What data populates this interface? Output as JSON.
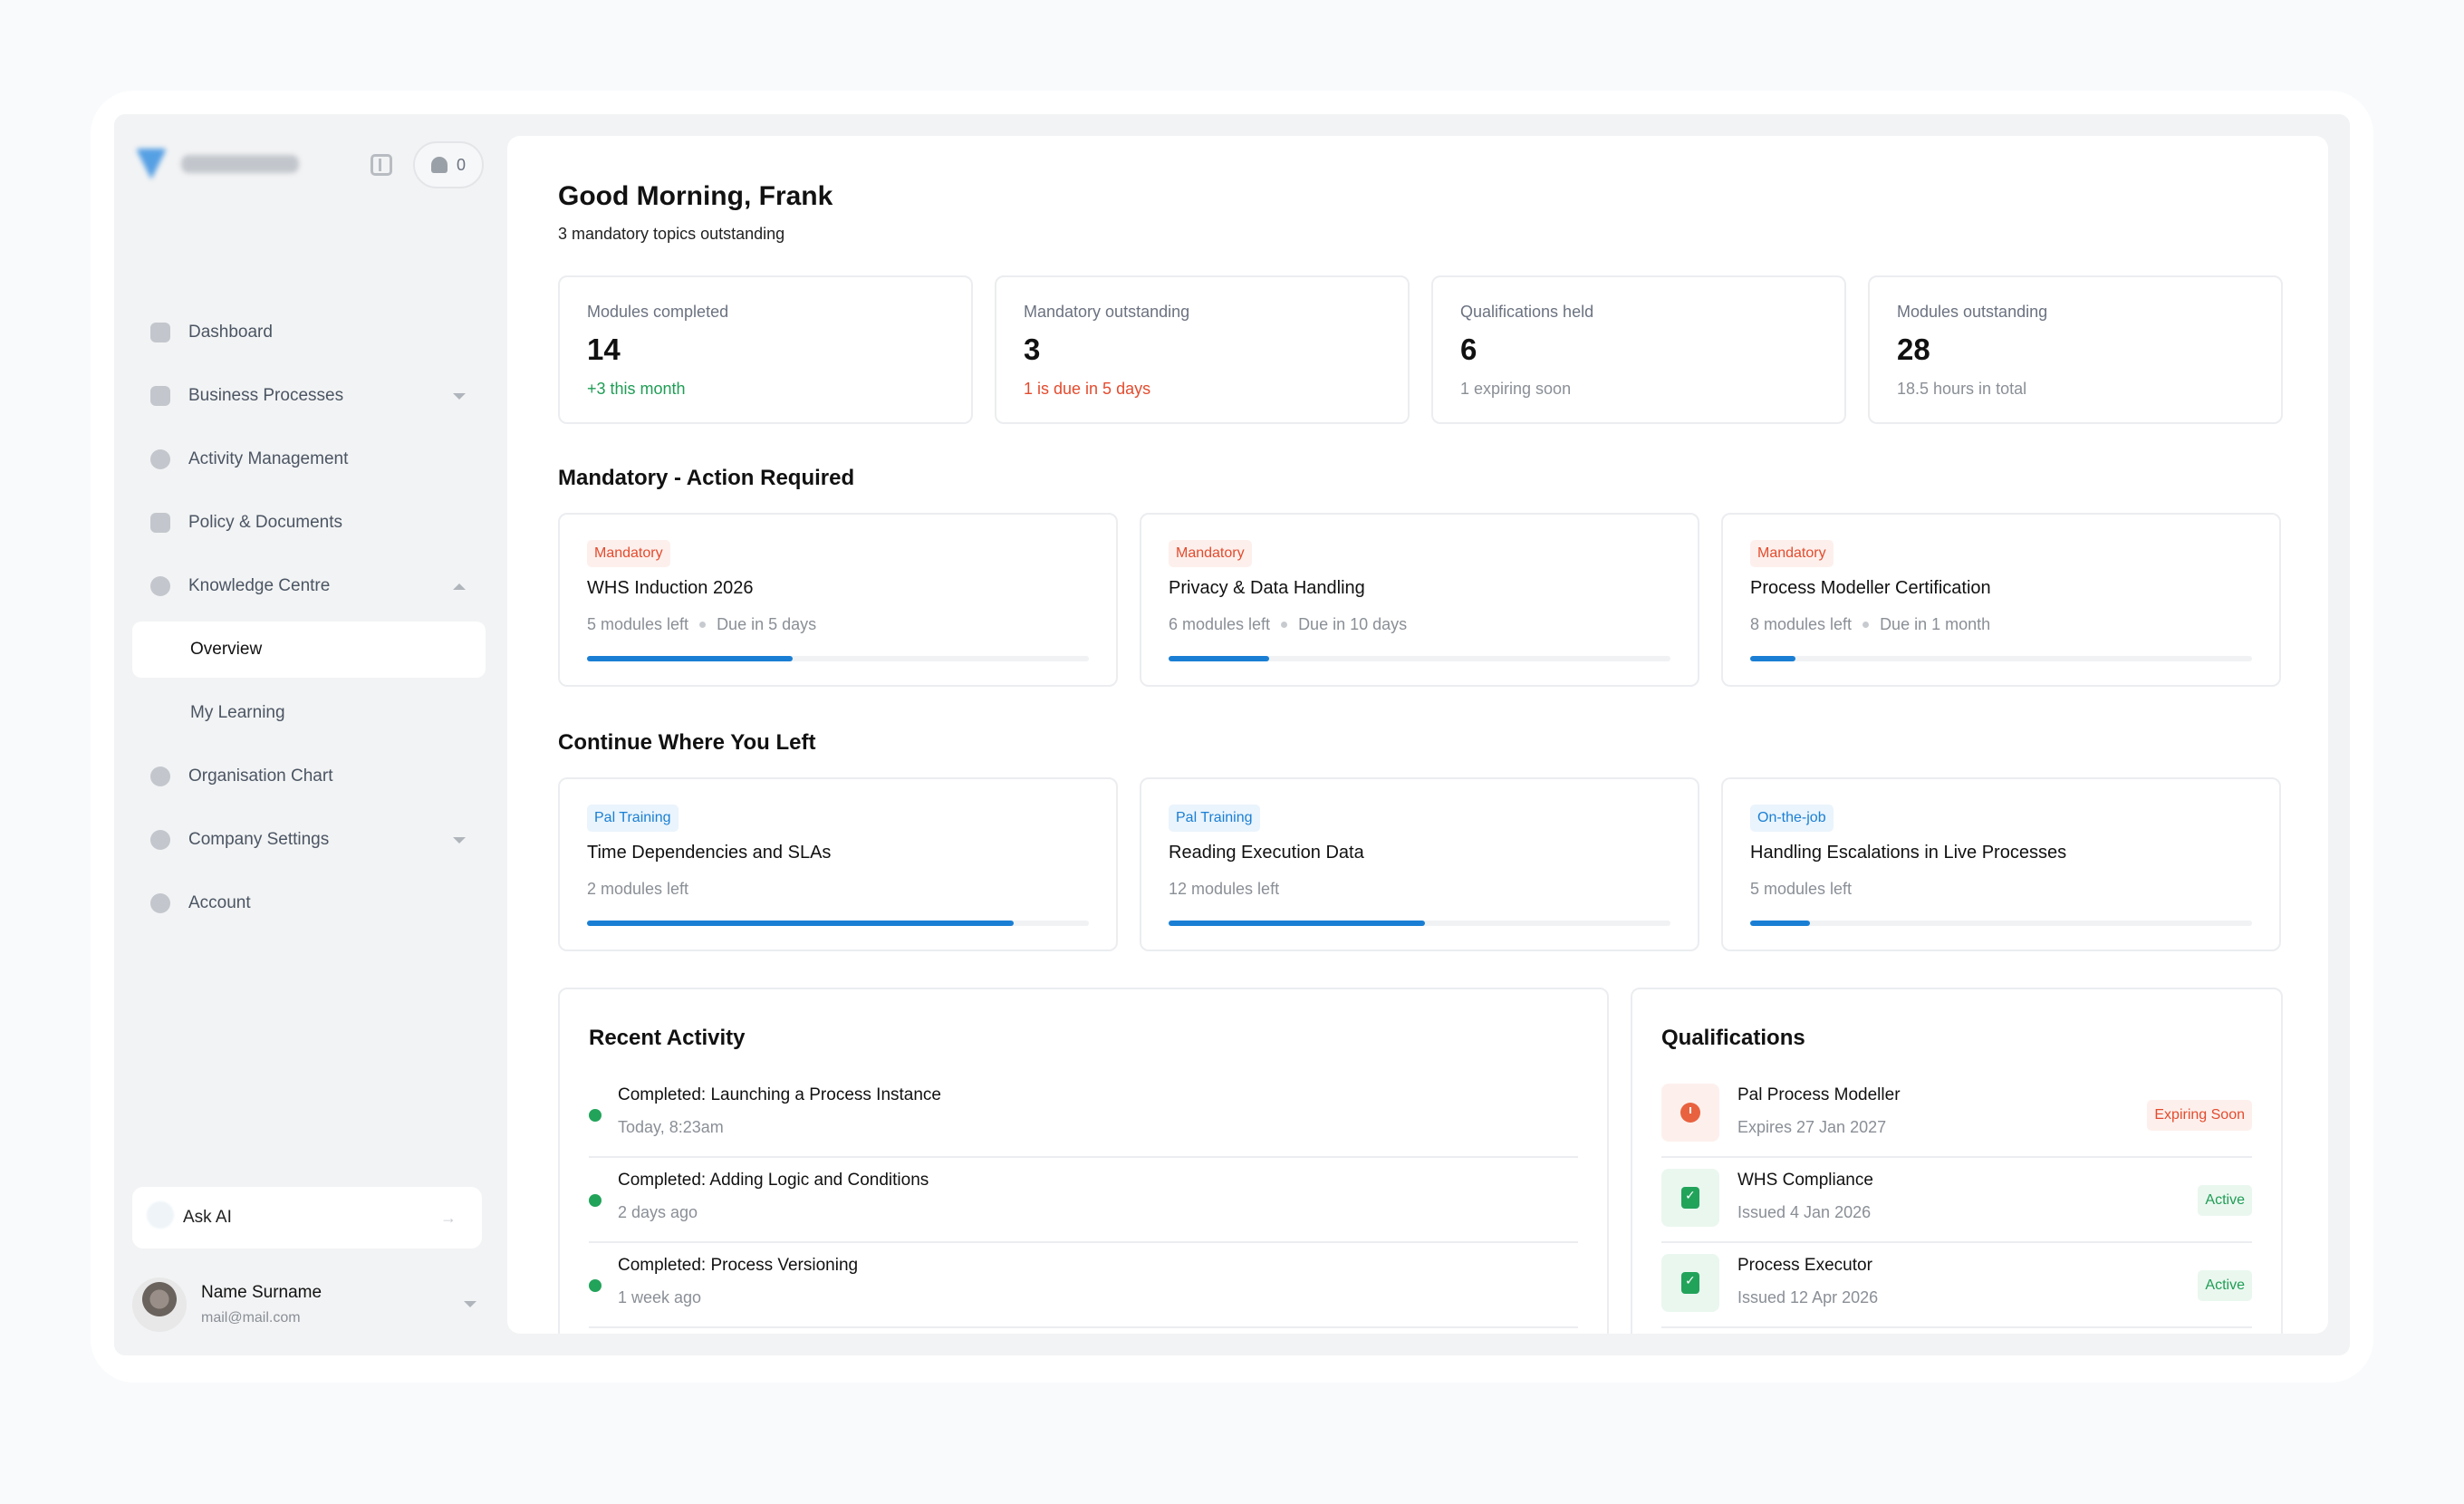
{
  "sidebar": {
    "notifications_count": "0",
    "nav": [
      {
        "label": "Dashboard",
        "icon": "home-icon"
      },
      {
        "label": "Business Processes",
        "icon": "grid-icon"
      },
      {
        "label": "Activity Management",
        "icon": "check-circle-icon"
      },
      {
        "label": "Policy & Documents",
        "icon": "document-icon"
      },
      {
        "label": "Knowledge Centre",
        "icon": "info-icon"
      }
    ],
    "knowledge_sub": [
      {
        "label": "Overview",
        "active": true
      },
      {
        "label": "My Learning",
        "active": false
      }
    ],
    "nav2": [
      {
        "label": "Organisation Chart",
        "icon": "people-icon"
      },
      {
        "label": "Company Settings",
        "icon": "gear-icon"
      },
      {
        "label": "Account",
        "icon": "user-icon"
      }
    ],
    "ask_ai": "Ask AI",
    "user": {
      "name": "Name Surname",
      "email": "mail@mail.com"
    }
  },
  "header": {
    "greeting": "Good Morning, Frank",
    "subtitle": "3 mandatory topics outstanding"
  },
  "stats": [
    {
      "label": "Modules completed",
      "value": "14",
      "note": "+3 this month",
      "note_color": "#1f9d55"
    },
    {
      "label": "Mandatory outstanding",
      "value": "3",
      "note": "1 is due in 5 days",
      "note_color": "#e34b2e"
    },
    {
      "label": "Qualifications held",
      "value": "6",
      "note": "1 expiring soon",
      "note_color": "#8a8f96"
    },
    {
      "label": "Modules outstanding",
      "value": "28",
      "note": "18.5 hours in total",
      "note_color": "#8a8f96"
    }
  ],
  "mandatory": {
    "title": "Mandatory - Action Required",
    "cards": [
      {
        "tag": "Mandatory",
        "title": "WHS Induction 2026",
        "modules": "5 modules left",
        "due": "Due in 5 days",
        "progress": 0.41
      },
      {
        "tag": "Mandatory",
        "title": "Privacy & Data Handling",
        "modules": "6 modules left",
        "due": "Due in 10 days",
        "progress": 0.2
      },
      {
        "tag": "Mandatory",
        "title": "Process Modeller Certification",
        "modules": "8 modules left",
        "due": "Due in 1 month",
        "progress": 0.09
      }
    ]
  },
  "continue": {
    "title": "Continue Where You Left",
    "cards": [
      {
        "tag": "Pal Training",
        "title": "Time Dependencies and SLAs",
        "modules": "2 modules left",
        "progress": 0.85
      },
      {
        "tag": "Pal Training",
        "title": "Reading Execution Data",
        "modules": "12 modules left",
        "progress": 0.51
      },
      {
        "tag": "On-the-job",
        "title": "Handling Escalations in Live Processes",
        "modules": "5 modules left",
        "progress": 0.12
      }
    ]
  },
  "recent_activity": {
    "title": "Recent Activity",
    "items": [
      {
        "text": "Completed: Launching a Process Instance",
        "time": "Today, 8:23am"
      },
      {
        "text": "Completed: Adding Logic and Conditions",
        "time": "2 days ago"
      },
      {
        "text": "Completed: Process Versioning",
        "time": "1 week ago"
      }
    ]
  },
  "qualifications": {
    "title": "Qualifications",
    "items": [
      {
        "name": "Pal Process Modeller",
        "date": "Expires 27 Jan 2027",
        "status": "Expiring Soon",
        "kind": "warn"
      },
      {
        "name": "WHS Compliance",
        "date": "Issued 4 Jan 2026",
        "status": "Active",
        "kind": "ok"
      },
      {
        "name": "Process Executor",
        "date": "Issued 12 Apr 2026",
        "status": "Active",
        "kind": "ok"
      }
    ]
  }
}
